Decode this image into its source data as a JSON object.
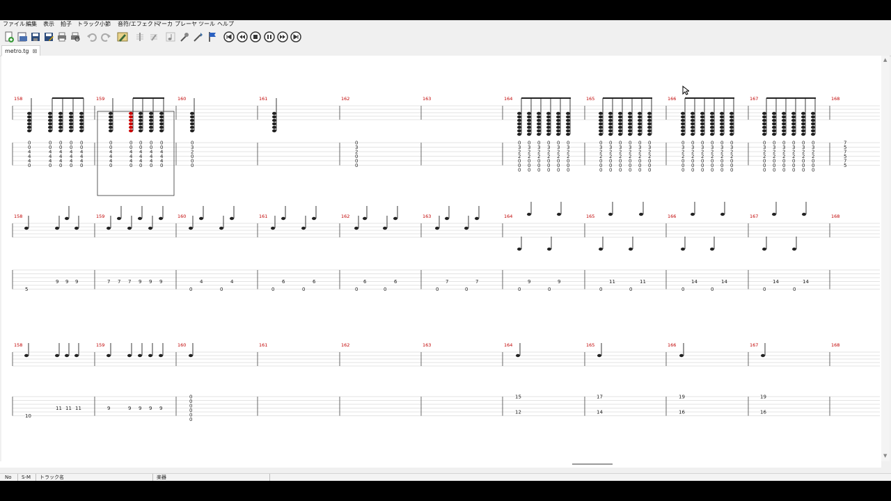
{
  "menubar": [
    "ファイル",
    "編集",
    "表示",
    "拍子",
    "トラック",
    "小節",
    "音符/エフェクト",
    "マーカ",
    "プレーヤ",
    "ツール",
    "ヘルプ"
  ],
  "toolbar": {
    "icons": [
      "new-file-icon",
      "open-folder-icon",
      "save-icon",
      "save-as-icon",
      "print-icon",
      "print-preview-icon",
      "undo-icon",
      "redo-icon",
      "edit-mode-icon",
      "add-beat-icon",
      "remove-beat-icon",
      "note-icon",
      "tuner-icon",
      "settings-icon",
      "marker-flag-icon",
      "first-icon",
      "previous-icon",
      "stop-icon",
      "pause-icon",
      "next-icon"
    ]
  },
  "tab": {
    "label": "metro.tg",
    "close": "⊠"
  },
  "score": {
    "measures": [
      "158",
      "159",
      "160",
      "161",
      "162",
      "163",
      "164",
      "165",
      "166",
      "167",
      "168"
    ],
    "systems": [
      {
        "tabs": [
          {
            "strings": [
              "0",
              "0",
              "4",
              "4",
              "4",
              "0"
            ],
            "cols": 1
          },
          {
            "strings": [
              "0",
              "0",
              "4",
              "4",
              "4",
              "0"
            ],
            "cols": 4
          },
          {
            "strings": [
              "0",
              "0",
              "4",
              "4",
              "4",
              "0"
            ],
            "cols": 1
          },
          {
            "strings": [
              "0",
              "0",
              "4",
              "4",
              "4",
              "0"
            ],
            "cols": 1
          },
          {
            "strings": [
              "0",
              "0",
              "4",
              "4",
              "4",
              "0"
            ],
            "cols": 3
          },
          {
            "strings": [
              "0",
              "3",
              "2",
              "0",
              "0",
              "0"
            ],
            "cols": 1
          },
          {
            "strings": [
              "0",
              "3",
              "2",
              "0",
              "0",
              "0"
            ],
            "cols": 1
          },
          {
            "strings": [
              "0",
              "3",
              "2",
              "2",
              "0",
              "0",
              "0"
            ],
            "cols": 7
          },
          {
            "strings": [
              "0",
              "3",
              "2",
              "2",
              "0",
              "0",
              "0"
            ],
            "cols": 7
          },
          {
            "strings": [
              "0",
              "3",
              "2",
              "2",
              "0",
              "0",
              "0"
            ],
            "cols": 7
          },
          {
            "strings": [
              "0",
              "3",
              "2",
              "2",
              "0",
              "0",
              "0"
            ],
            "cols": 7
          },
          {
            "strings": [
              "7",
              "5",
              "7",
              "5",
              "7",
              "5"
            ],
            "cols": 1
          }
        ]
      },
      {
        "tabs": [
          {
            "values": [
              "5"
            ]
          },
          {
            "values": [
              "9",
              "9",
              "9"
            ]
          },
          {
            "values": [
              "7",
              "7",
              "7",
              "9",
              "9",
              "9"
            ]
          },
          {
            "values": [
              "0",
              "4",
              "0",
              "4"
            ]
          },
          {
            "values": [
              "0",
              "6",
              "0",
              "6"
            ]
          },
          {
            "values": [
              "0",
              "6",
              "0",
              "6"
            ]
          },
          {
            "values": [
              "0",
              "7",
              "0",
              "7"
            ]
          },
          {
            "values": [
              "0",
              "9",
              "0",
              "9"
            ]
          },
          {
            "values": [
              "0",
              "11",
              "0",
              "11"
            ]
          },
          {
            "values": [
              "0",
              "14",
              "0",
              "14"
            ]
          },
          {
            "values": [
              "0",
              "14",
              "0",
              "14"
            ]
          }
        ]
      },
      {
        "tabs": [
          {
            "values": [
              "10"
            ]
          },
          {
            "values": [
              "11",
              "11",
              "11"
            ]
          },
          {
            "values": [
              "9",
              "9",
              "9",
              "9",
              "9"
            ]
          },
          {
            "values": [
              "0",
              "0",
              "0",
              "0",
              "0",
              "0"
            ]
          },
          {
            "values": [
              "15",
              "12"
            ]
          },
          {
            "values": [
              "17",
              "14"
            ]
          },
          {
            "values": [
              "19",
              "16"
            ]
          },
          {
            "values": [
              "19",
              "16"
            ]
          }
        ]
      }
    ]
  },
  "trackheader": {
    "no": "No",
    "sm": "S-M",
    "name": "トラック名",
    "score": "楽器"
  }
}
